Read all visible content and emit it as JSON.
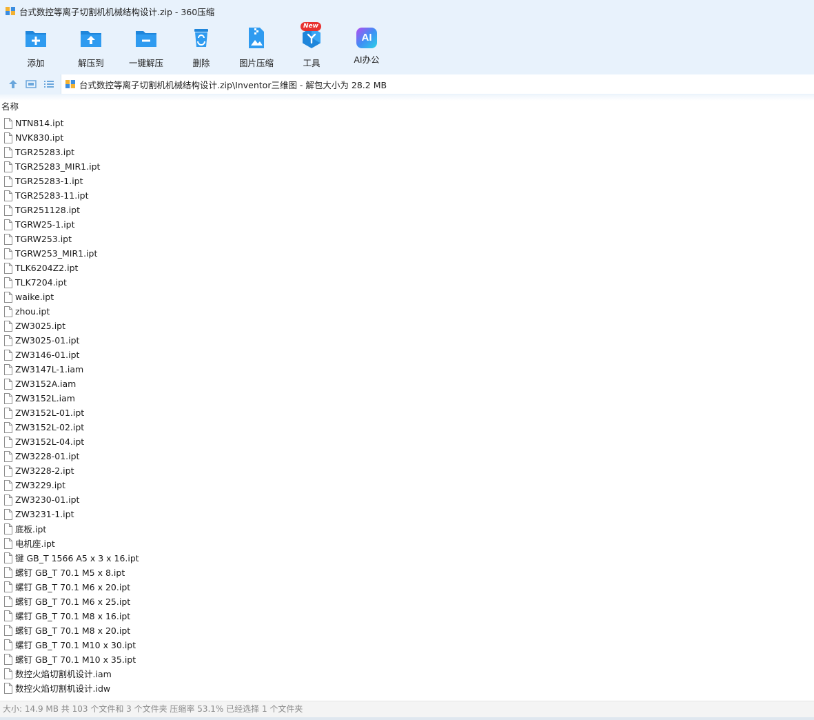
{
  "window": {
    "title": "台式数控等离子切割机机械结构设计.zip - 360压缩"
  },
  "toolbar": {
    "items": [
      {
        "label": "添加",
        "icon": "add-folder-icon"
      },
      {
        "label": "解压到",
        "icon": "extract-to-icon"
      },
      {
        "label": "一键解压",
        "icon": "one-click-extract-icon"
      },
      {
        "label": "删除",
        "icon": "recycle-bin-icon"
      },
      {
        "label": "图片压缩",
        "icon": "image-compress-icon"
      },
      {
        "label": "工具",
        "icon": "tools-icon",
        "badge": "New"
      },
      {
        "label": "AI办公",
        "icon": "ai-office-icon",
        "glyph": "AI"
      }
    ]
  },
  "address": {
    "path": "台式数控等离子切割机机械结构设计.zip\\Inventor三维图 - 解包大小为 28.2 MB"
  },
  "list": {
    "column_header": "名称",
    "files": [
      "NTN814.ipt",
      "NVK830.ipt",
      "TGR25283.ipt",
      "TGR25283_MIR1.ipt",
      "TGR25283-1.ipt",
      "TGR25283-11.ipt",
      "TGR251128.ipt",
      "TGRW25-1.ipt",
      "TGRW253.ipt",
      "TGRW253_MIR1.ipt",
      "TLK6204Z2.ipt",
      "TLK7204.ipt",
      "waike.ipt",
      "zhou.ipt",
      "ZW3025.ipt",
      "ZW3025-01.ipt",
      "ZW3146-01.ipt",
      "ZW3147L-1.iam",
      "ZW3152A.iam",
      "ZW3152L.iam",
      "ZW3152L-01.ipt",
      "ZW3152L-02.ipt",
      "ZW3152L-04.ipt",
      "ZW3228-01.ipt",
      "ZW3228-2.ipt",
      "ZW3229.ipt",
      "ZW3230-01.ipt",
      "ZW3231-1.ipt",
      "底板.ipt",
      "电机座.ipt",
      "键 GB_T 1566 A5 x 3 x 16.ipt",
      "螺钉 GB_T 70.1 M5 x 8.ipt",
      "螺钉 GB_T 70.1 M6 x 20.ipt",
      "螺钉 GB_T 70.1 M6 x 25.ipt",
      "螺钉 GB_T 70.1 M8 x 16.ipt",
      "螺钉 GB_T 70.1 M8 x 20.ipt",
      "螺钉 GB_T 70.1 M10 x 30.ipt",
      "螺钉 GB_T 70.1 M10 x 35.ipt",
      "数控火焰切割机设计.iam",
      "数控火焰切割机设计.idw"
    ]
  },
  "status": {
    "text": "大小: 14.9 MB 共 103 个文件和 3 个文件夹 压缩率 53.1% 已经选择 1 个文件夹"
  },
  "colors": {
    "toolbar_bg": "#e8f2fc",
    "icon_blue": "#2a8fe0",
    "badge_red": "#e8312f"
  }
}
